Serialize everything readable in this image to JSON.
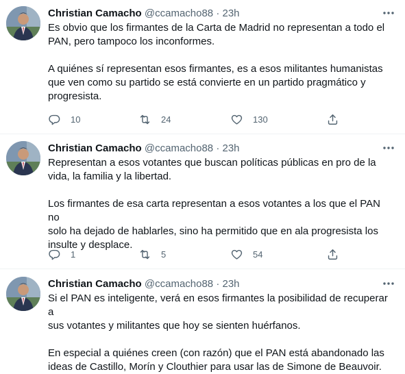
{
  "tweets": [
    {
      "name": "Christian Camacho",
      "handle": "@ccamacho88",
      "separator": "·",
      "time": "23h",
      "paragraphs": [
        "Es obvio que los firmantes de la Carta de Madrid no representan a todo el\nPAN, pero tampoco los inconformes.",
        "A quiénes sí representan esos firmantes, es a esos militantes humanistas\nque ven como su partido se está convierte en un partido pragmático y\nprogresista."
      ],
      "replies": "10",
      "retweets": "24",
      "likes": "130"
    },
    {
      "name": "Christian Camacho",
      "handle": "@ccamacho88",
      "separator": "·",
      "time": "23h",
      "paragraphs": [
        "Representan a esos votantes que buscan políticas públicas en pro de la\nvida, la familia y la libertad.",
        "Los firmantes de esa carta representan a esos votantes a los que el PAN no\nsolo ha dejado de hablarles, sino ha permitido que en ala progresista los\ninsulte y desplace."
      ],
      "replies": "1",
      "retweets": "5",
      "likes": "54"
    },
    {
      "name": "Christian Camacho",
      "handle": "@ccamacho88",
      "separator": "·",
      "time": "23h",
      "paragraphs": [
        "Si el PAN es inteligente, verá en esos firmantes la posibilidad de recuperar a\nsus votantes y militantes que hoy se sienten huérfanos.",
        "En especial a quiénes creen (con razón) que el PAN está abandonado las\nideas de Castillo, Morín y Clouthier para usar las de Simone de Beauvoir."
      ]
    }
  ],
  "colors": {
    "text": "#0f1419",
    "secondary": "#536471",
    "divider": "#eff3f4"
  },
  "icons": [
    "more-icon",
    "reply-icon",
    "retweet-icon",
    "like-icon",
    "share-icon"
  ]
}
